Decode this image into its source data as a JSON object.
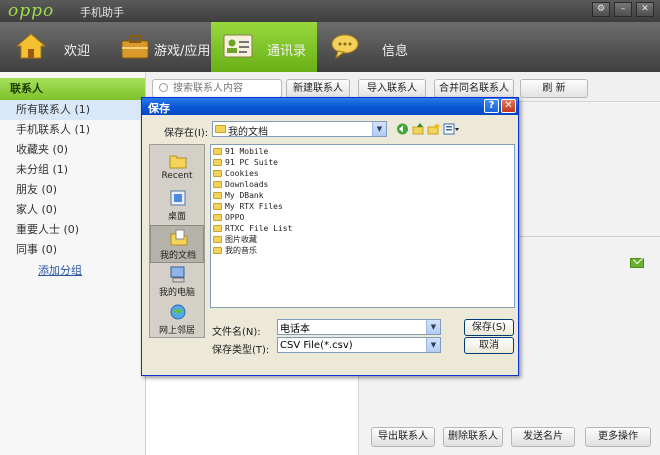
{
  "app": {
    "logo": "oppo",
    "title": "手机助手",
    "window_buttons": [
      "⚙",
      "–",
      "✕"
    ]
  },
  "nav": {
    "items": [
      {
        "label": "欢迎",
        "icon": "home-icon"
      },
      {
        "label": "游戏/应用",
        "icon": "briefcase-icon"
      },
      {
        "label": "通讯录",
        "icon": "contacts-icon",
        "active": true
      },
      {
        "label": "信息",
        "icon": "speech-bubble-icon"
      }
    ]
  },
  "sidebar": {
    "header": "联系人",
    "items": [
      {
        "label": "所有联系人 (1)",
        "selected": true
      },
      {
        "label": "手机联系人 (1)"
      },
      {
        "label": "收藏夹 (0)"
      },
      {
        "label": "未分组 (1)"
      },
      {
        "label": "朋友 (0)"
      },
      {
        "label": "家人 (0)"
      },
      {
        "label": "重要人士 (0)"
      },
      {
        "label": "同事 (0)"
      }
    ],
    "add_group": "添加分组"
  },
  "toolbar": {
    "search_placeholder": "搜索联系人内容",
    "new_contact": "新建联系人",
    "import_contact": "导入联系人",
    "merge_contact": "合并同名联系人",
    "refresh": "刷  新"
  },
  "bottom_bar": {
    "export": "导出联系人",
    "delete": "删除联系人",
    "send_card": "发送名片",
    "more": "更多操作"
  },
  "dialog": {
    "title": "保存",
    "help_button": "?",
    "close_button": "✕",
    "save_in_label": "保存在(I):",
    "save_in_value": "我的文档",
    "places": [
      {
        "label": "Recent",
        "icon": "recent-folder-icon"
      },
      {
        "label": "桌面",
        "icon": "desktop-icon"
      },
      {
        "label": "我的文档",
        "icon": "my-documents-icon",
        "active": true
      },
      {
        "label": "我的电脑",
        "icon": "my-computer-icon"
      },
      {
        "label": "网上邻居",
        "icon": "network-places-icon"
      }
    ],
    "files": [
      "91 Mobile",
      "91 PC Suite",
      "Cookies",
      "Downloads",
      "My DBank",
      "My RTX Files",
      "OPPO",
      "RTXC File List",
      "图片收藏",
      "我的音乐"
    ],
    "filename_label": "文件名(N):",
    "filename_value": "电话本",
    "filetype_label": "保存类型(T):",
    "filetype_value": "CSV File(*.csv)",
    "save_button": "保存(S)",
    "cancel_button": "取消"
  },
  "colors": {
    "accent_green": "#7ec12c",
    "titlebar_dark": "#3e3e3e",
    "dialog_blue": "#0a58d6"
  }
}
